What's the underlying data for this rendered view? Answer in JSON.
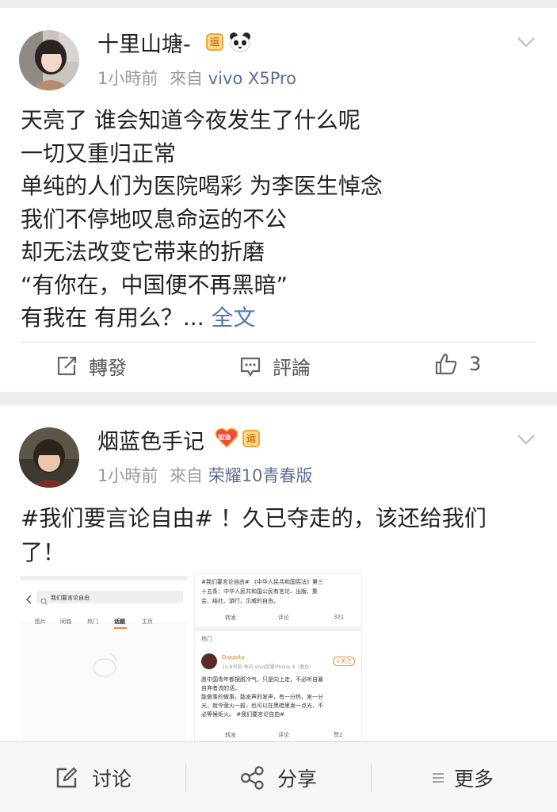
{
  "posts": [
    {
      "username": "十里山塘-",
      "badge_text": "运",
      "time": "1小時前",
      "from_label": "來自",
      "source": "vivo X5Pro",
      "lines": [
        "天亮了 谁会知道今夜发生了什么呢",
        "一切又重归正常",
        "单纯的人们为医院喝彩 为李医生悼念",
        "我们不停地叹息命运的不公",
        "却无法改变它带来的折磨",
        "“有你在，中国便不再黑暗”",
        "有我在 有用么？..."
      ],
      "read_more": "全文",
      "actions": {
        "repost": "轉發",
        "comment": "評論",
        "like_count": "3"
      }
    },
    {
      "username": "烟蓝色手记",
      "heart_text": "加油",
      "badge_text": "运",
      "time": "1小時前",
      "from_label": "來自",
      "source": "荣耀10青春版",
      "lines": [
        "#我们要言论自由# ！久已夺走的，该还给我们",
        "了！"
      ],
      "thumb1": {
        "search_text": "我们要言论自由",
        "tabs": [
          "图片",
          "同城",
          "热门",
          "话题",
          "主页"
        ]
      },
      "thumb2": {
        "text_lines": [
          "#我们要言论自由# 《中华人民共和国宪法》第三",
          "十五条：中华人民共和国公民有言论、出版、集",
          "会、结社、游行、示威的自由。"
        ],
        "actions": [
          "转发",
          "评论",
          "321"
        ],
        "hot_label": "热门",
        "user": "Diaosita",
        "meta": "10-8号前   来自 Vivo超薄iPhone 8（面色）",
        "follow": "+关注",
        "body_lines": [
          "愿中国青年都摆脱冷气，只是向上走，不必听自暴",
          "自弃者流的话。",
          "能做事的做事，能发声的发声，有一分热，发一分",
          "光，就令萤火一般，也可以在黑暗里发一点光，不",
          "必等候炬火。 #我们要言论自由#"
        ],
        "bottom": [
          "转发",
          "评论",
          "赞2"
        ]
      }
    }
  ],
  "bottom_bar": {
    "discuss": "讨论",
    "share": "分享",
    "more": "更多"
  },
  "colors": {
    "link": "#4b76b8",
    "source": "#5a6f96",
    "meta": "#9a9a9a"
  }
}
